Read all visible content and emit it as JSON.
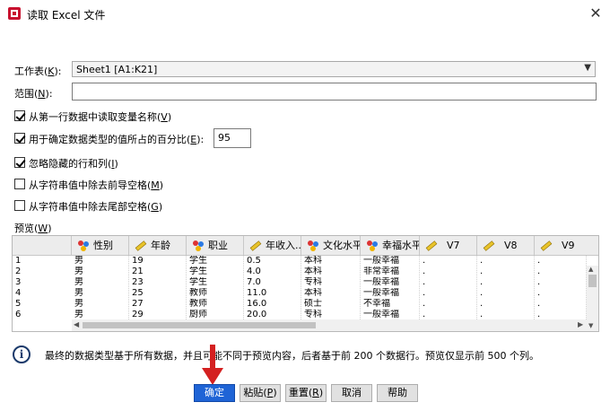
{
  "window": {
    "title": "读取 Excel 文件",
    "close": "✕"
  },
  "worksheet": {
    "label": "工作表(",
    "key": "K",
    "label_end": "):",
    "value": "Sheet1 [A1:K21]"
  },
  "range": {
    "label": "范围(",
    "key": "N",
    "label_end": "):",
    "value": ""
  },
  "options": [
    {
      "text": "从第一行数据中读取变量名称(",
      "key": "V",
      "end": ")",
      "checked": true
    },
    {
      "text": "用于确定数据类型的值所占的百分比(",
      "key": "E",
      "end": "):",
      "checked": true
    },
    {
      "text": "忽略隐藏的行和列(",
      "key": "I",
      "end": ")",
      "checked": true
    },
    {
      "text": "从字符串值中除去前导空格(",
      "key": "M",
      "end": ")",
      "checked": false
    },
    {
      "text": "从字符串值中除去尾部空格(",
      "key": "G",
      "end": ")",
      "checked": false
    }
  ],
  "percent_value": "95",
  "preview": {
    "label": "预览(",
    "key": "W",
    "label_end": ")",
    "columns": [
      {
        "name": "性别",
        "icon": "nominal-icon"
      },
      {
        "name": "年龄",
        "icon": "scale-icon"
      },
      {
        "name": "职业",
        "icon": "nominal-icon"
      },
      {
        "name": "年收入...",
        "icon": "scale-icon"
      },
      {
        "name": "文化水平",
        "icon": "nominal-icon"
      },
      {
        "name": "幸福水平",
        "icon": "nominal-icon"
      },
      {
        "name": "V7",
        "icon": "scale-icon"
      },
      {
        "name": "V8",
        "icon": "scale-icon"
      },
      {
        "name": "V9",
        "icon": "scale-icon"
      }
    ],
    "rows": [
      [
        "1",
        "男",
        "19",
        "学生",
        "0.5",
        "本科",
        "一般幸福",
        ".",
        ".",
        "."
      ],
      [
        "2",
        "男",
        "21",
        "学生",
        "4.0",
        "本科",
        "非常幸福",
        ".",
        ".",
        "."
      ],
      [
        "3",
        "男",
        "23",
        "学生",
        "7.0",
        "专科",
        "一般幸福",
        ".",
        ".",
        "."
      ],
      [
        "4",
        "男",
        "25",
        "教师",
        "11.0",
        "本科",
        "一般幸福",
        ".",
        ".",
        "."
      ],
      [
        "5",
        "男",
        "27",
        "教师",
        "16.0",
        "硕士",
        "不幸福",
        ".",
        ".",
        "."
      ],
      [
        "6",
        "男",
        "29",
        "厨师",
        "20.0",
        "专科",
        "一般幸福",
        ".",
        ".",
        "."
      ]
    ]
  },
  "info": "最终的数据类型基于所有数据，并且可能不同于预览内容，后者基于前 200 个数据行。预览仅显示前 500 个列。",
  "buttons": {
    "ok": "确定",
    "paste_a": "粘贴(",
    "paste_key": "P",
    "paste_b": ")",
    "reset_a": "重置(",
    "reset_key": "R",
    "reset_b": ")",
    "cancel": "取消",
    "help": "帮助"
  },
  "colors": {
    "accent": "#1f64d6",
    "arrow": "#d42020"
  }
}
